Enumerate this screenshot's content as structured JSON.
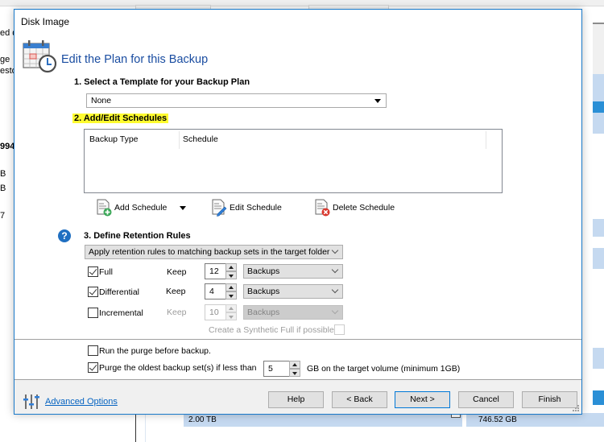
{
  "background_window": {
    "left_fragments": [
      "ed d",
      "ge",
      "esto",
      "994",
      "B",
      "B",
      "7"
    ],
    "cells": [
      "2.00 TB",
      "746.52 GB"
    ]
  },
  "dialog": {
    "title": "Disk Image",
    "header": {
      "icon": "calendar-clock-icon",
      "title": "Edit the Plan for this Backup"
    },
    "section1": {
      "label": "1. Select a Template for your Backup Plan",
      "template_value": "None"
    },
    "section2": {
      "label": "2. Add/Edit Schedules",
      "highlight_color": "#fffc30",
      "columns": [
        "Backup Type",
        "Schedule"
      ],
      "rows": [],
      "buttons": {
        "add": "Add Schedule",
        "edit": "Edit Schedule",
        "delete": "Delete Schedule"
      }
    },
    "section3": {
      "label": "3. Define Retention Rules",
      "help_icon": "question-circle-icon",
      "retention_mode": "Apply retention rules to matching backup sets in the target folder",
      "rules": [
        {
          "type": "Full",
          "checked": true,
          "keep_label": "Keep",
          "count": "12",
          "unit": "Backups",
          "enabled": true
        },
        {
          "type": "Differential",
          "checked": true,
          "keep_label": "Keep",
          "count": "4",
          "unit": "Backups",
          "enabled": true
        },
        {
          "type": "Incremental",
          "checked": false,
          "keep_label": "Keep",
          "count": "10",
          "unit": "Backups",
          "enabled": false
        }
      ],
      "synthetic_full_label": "Create a Synthetic Full if possible",
      "synthetic_full_checked": false
    },
    "purge": {
      "run_before_label": "Run the purge before backup.",
      "run_before_checked": false,
      "purge_oldest_label": "Purge the oldest backup set(s) if less than",
      "purge_oldest_checked": true,
      "purge_value": "5",
      "purge_suffix": "GB on the target volume (minimum 1GB)"
    },
    "footer": {
      "advanced_options": "Advanced Options",
      "buttons": {
        "help": "Help",
        "back": "< Back",
        "next": "Next >",
        "cancel": "Cancel",
        "finish": "Finish"
      }
    },
    "accent_color": "#1979ca",
    "link_color": "#0563c1"
  }
}
